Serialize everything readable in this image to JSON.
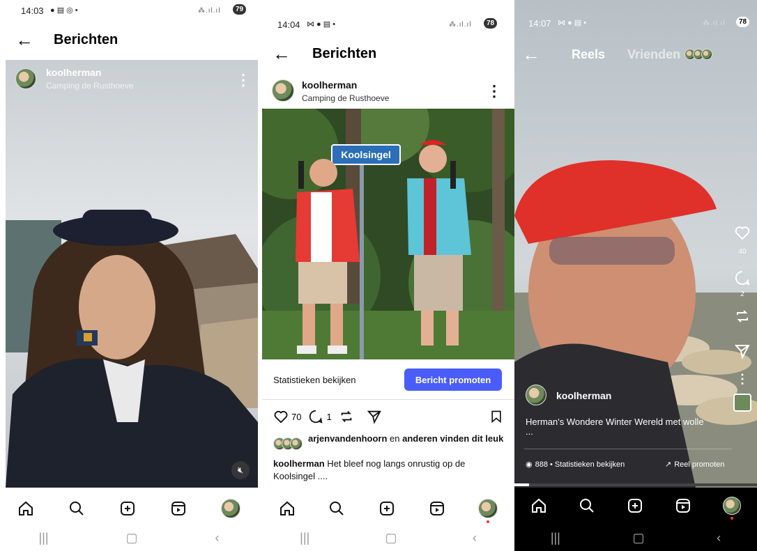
{
  "panel1": {
    "status": {
      "time": "14:03",
      "icons": "● ▤ ◎ •",
      "signal": "⁂.ıl.ıl",
      "battery": "79"
    },
    "header": {
      "title": "Berichten"
    },
    "post": {
      "username": "koolherman",
      "location": "Camping de Rusthoeve"
    }
  },
  "panel2": {
    "status": {
      "time": "14:04",
      "icons": "⋈ ● ▤ •",
      "signal": "⁂.ıl.ıl",
      "battery": "78"
    },
    "header": {
      "title": "Berichten"
    },
    "post": {
      "username": "koolherman",
      "location": "Camping de Rusthoeve",
      "sign_text": "Koolsingel"
    },
    "actions": {
      "stats_label": "Statistieken bekijken",
      "promote_label": "Bericht promoten",
      "like_count": "70",
      "comment_count": "1"
    },
    "likes": {
      "user": "arjenvandenhoorn",
      "mid": " en ",
      "rest": "anderen vinden dit leuk"
    },
    "caption": {
      "user": "koolherman",
      "text": " Het bleef nog langs onrustig op de Koolsingel ...."
    }
  },
  "panel3": {
    "status": {
      "time": "14:07",
      "icons": "⋈ ● ▤ •",
      "signal": "⁂.ıl.ıl",
      "battery": "78"
    },
    "tabs": {
      "reels": "Reels",
      "friends": "Vrienden"
    },
    "side": {
      "like_count": "40",
      "comment_count": "2"
    },
    "reel": {
      "username": "koolherman",
      "caption": "Herman's Wondere Winter Wereld met wolle",
      "more": "...",
      "views": "888 • Statistieken bekijken",
      "promote": "Reel promoten"
    }
  },
  "colors": {
    "accent": "#4a5df9",
    "notification": "#ff3040"
  }
}
